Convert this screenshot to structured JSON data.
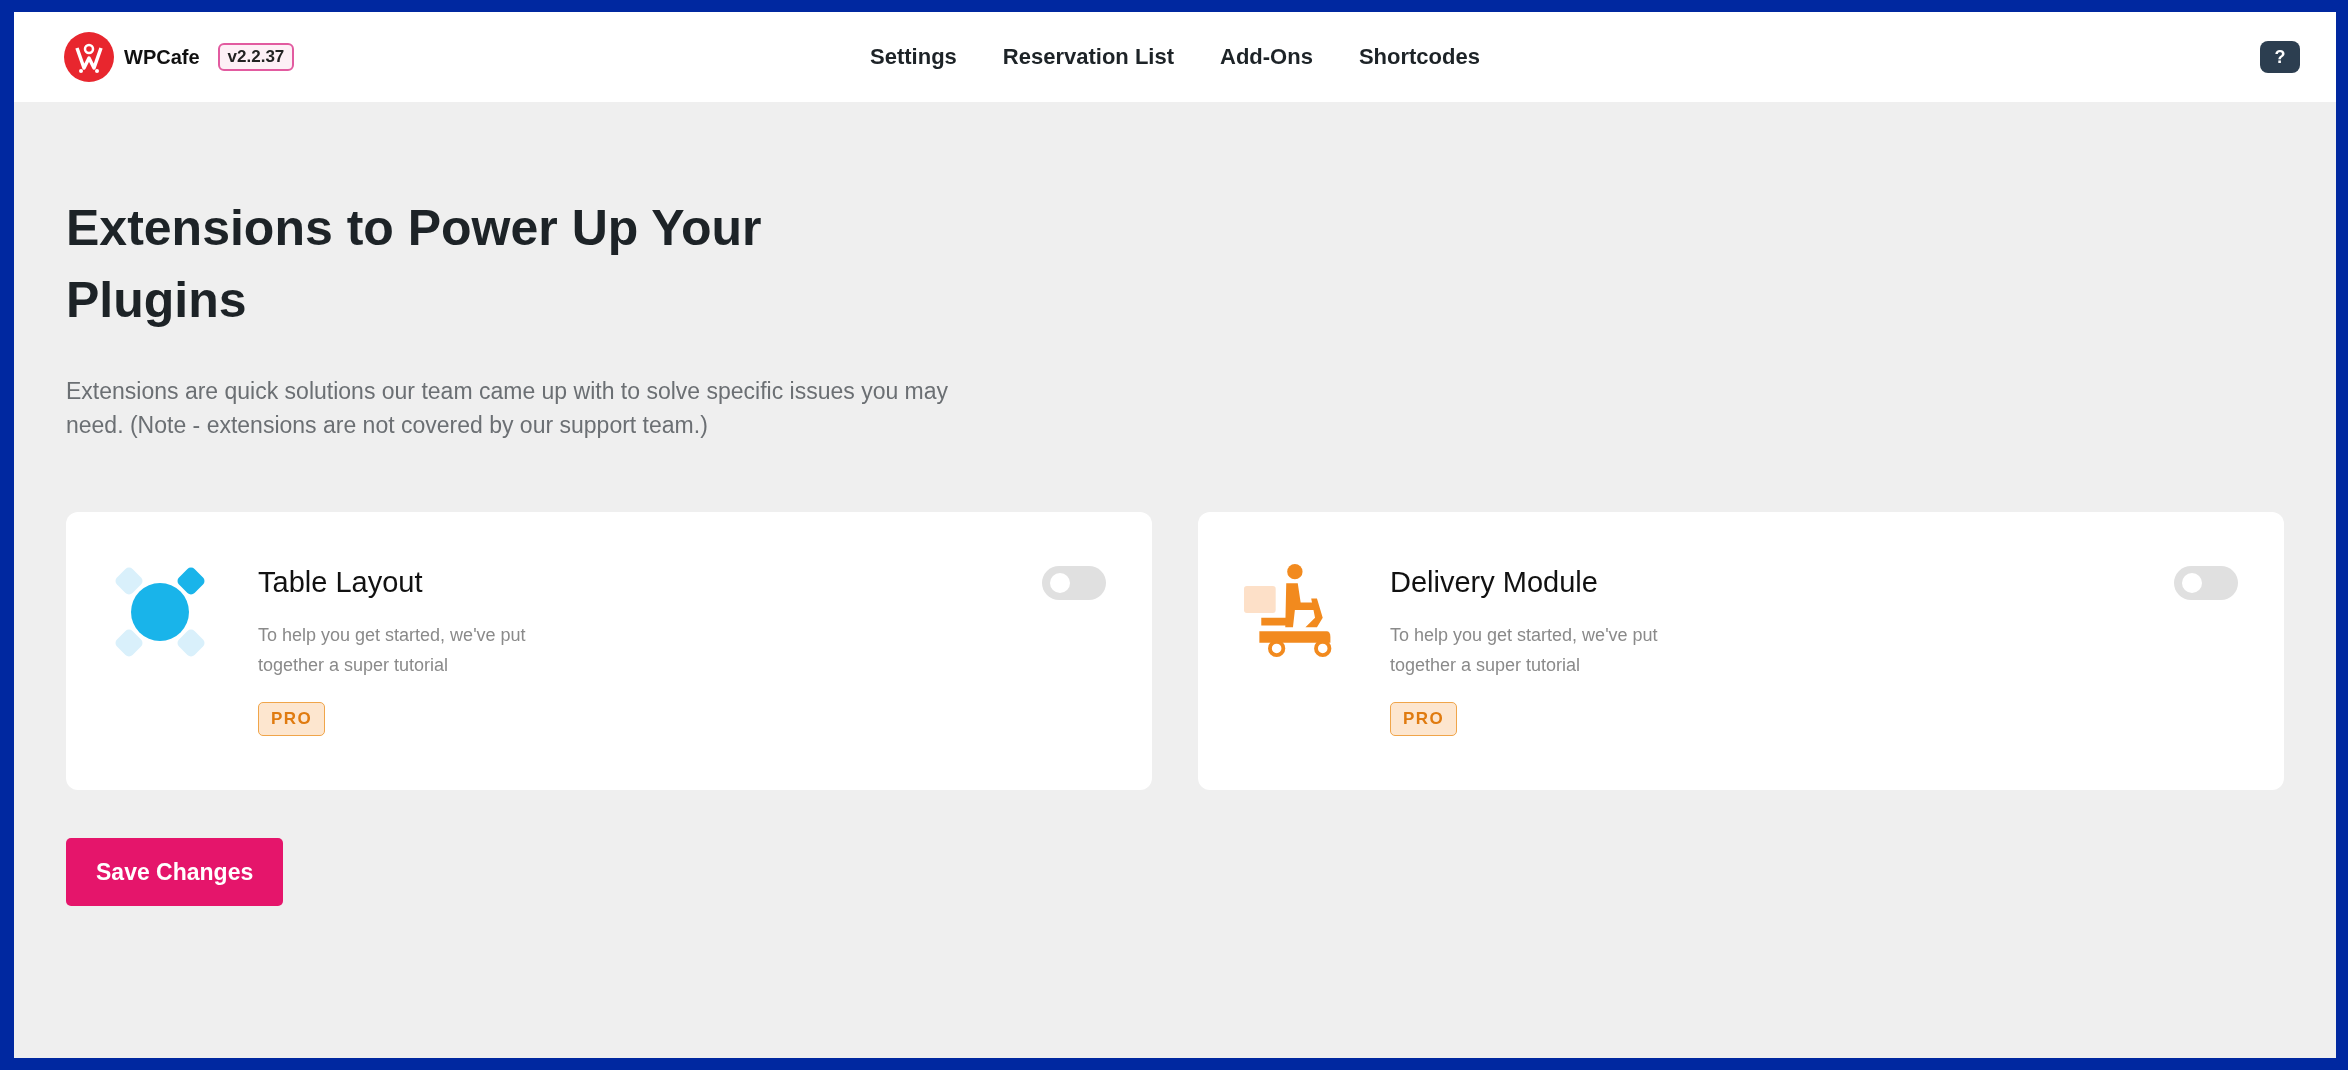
{
  "header": {
    "logo": "WPCafe",
    "version": "v2.2.37",
    "nav": [
      {
        "label": "Settings"
      },
      {
        "label": "Reservation List"
      },
      {
        "label": "Add-Ons"
      },
      {
        "label": "Shortcodes"
      }
    ],
    "help": "?"
  },
  "title": "Extensions to Power Up Your Plugins",
  "description": "Extensions are quick solutions our team came up with to solve specific issues you may need. (Note - extensions are not covered by our support team.)",
  "extensions": [
    {
      "kind": "table",
      "name": "Table Layout",
      "description": "To help you get started, we've put together a super tutorial",
      "badge": "PRO",
      "on": false
    },
    {
      "kind": "delivery",
      "name": "Delivery Module",
      "description": "To help you get started, we've put together a super tutorial",
      "badge": "PRO",
      "on": false
    }
  ],
  "save_button": "Save Changes"
}
